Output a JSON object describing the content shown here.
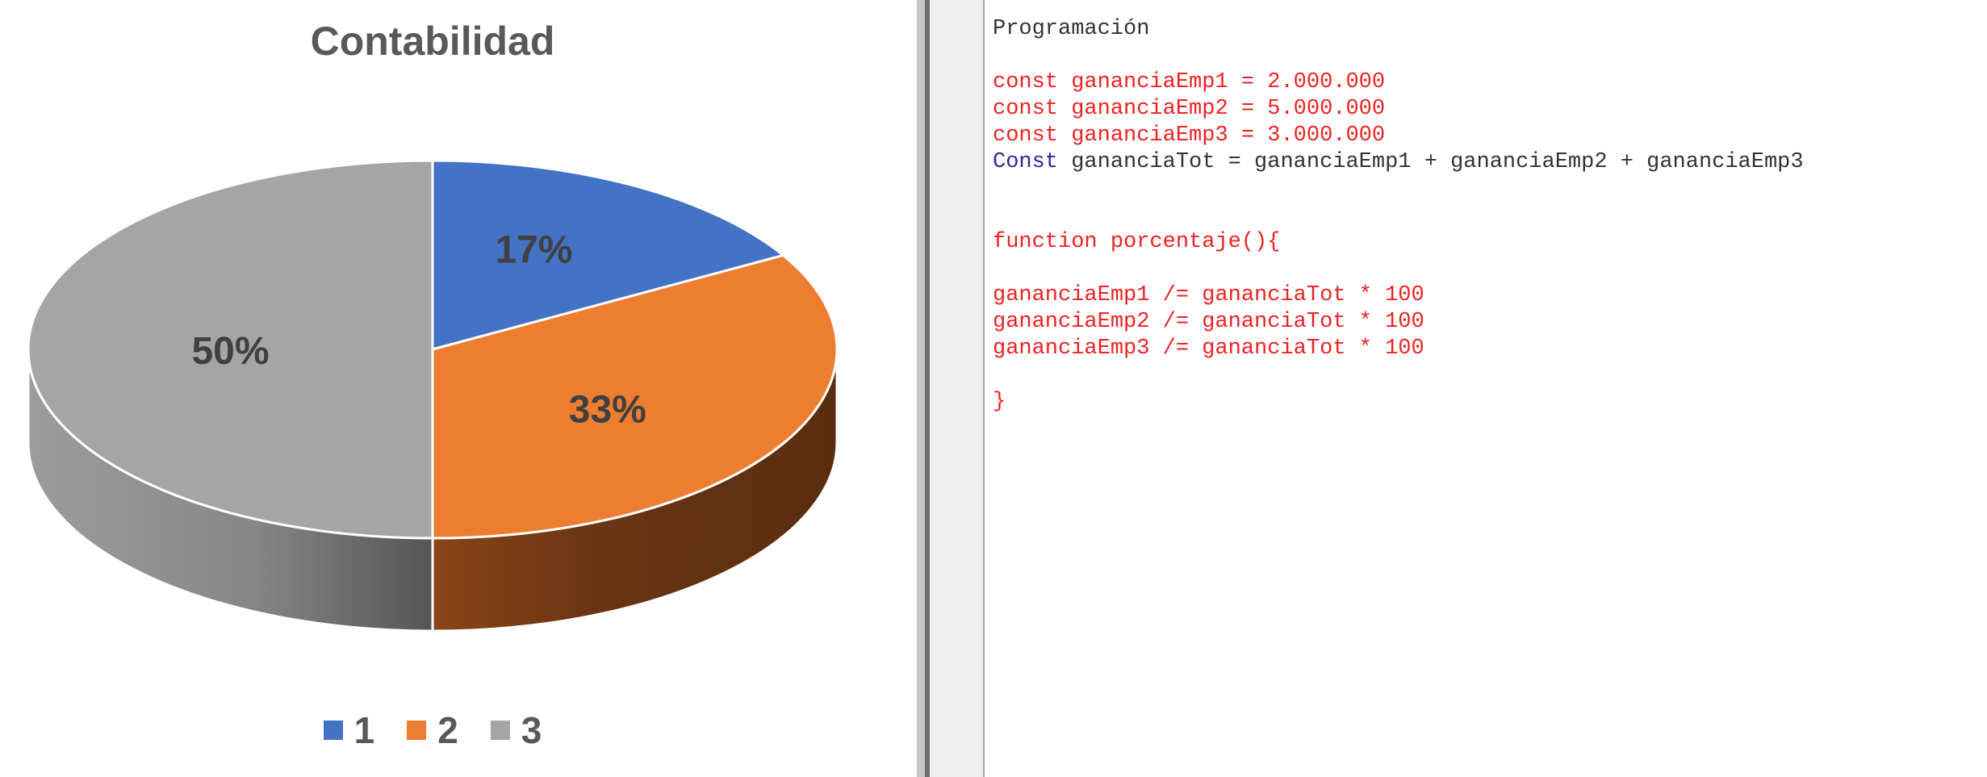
{
  "chart_data": {
    "type": "pie",
    "title": "Contabilidad",
    "categories": [
      "1",
      "2",
      "3"
    ],
    "values": [
      16.7,
      33.3,
      50
    ],
    "data_labels": [
      "17%",
      "33%",
      "50%"
    ],
    "colors": [
      "#4472c4",
      "#ed7d31",
      "#a5a5a5"
    ],
    "style": "3d",
    "legend": "bottom"
  },
  "editor": {
    "lines": [
      {
        "text": "Programación",
        "style": "plain"
      },
      {
        "text": "",
        "style": "red"
      },
      {
        "text": "const gananciaEmp1 = 2.000.000",
        "style": "red"
      },
      {
        "text": "const gananciaEmp2 = 5.000.000",
        "style": "red"
      },
      {
        "text": "const gananciaEmp3 = 3.000.000",
        "style": "red"
      },
      {
        "text": "Const gananciaTot = gananciaEmp1 + gananciaEmp2 + gananciaEmp3",
        "style": "const"
      },
      {
        "text": "",
        "style": "red"
      },
      {
        "text": "",
        "style": "red"
      },
      {
        "text": "function porcentaje(){",
        "style": "red"
      },
      {
        "text": "",
        "style": "red"
      },
      {
        "text": "gananciaEmp1 /= gananciaTot * 100",
        "style": "red"
      },
      {
        "text": "gananciaEmp2 /= gananciaTot * 100",
        "style": "red"
      },
      {
        "text": "gananciaEmp3 /= gananciaTot * 100",
        "style": "red"
      },
      {
        "text": "",
        "style": "red"
      },
      {
        "text": "}",
        "style": "red"
      }
    ],
    "colors": {
      "code": "#ee2222",
      "keyword": "#2a2a9a",
      "plain": "#333333"
    }
  }
}
